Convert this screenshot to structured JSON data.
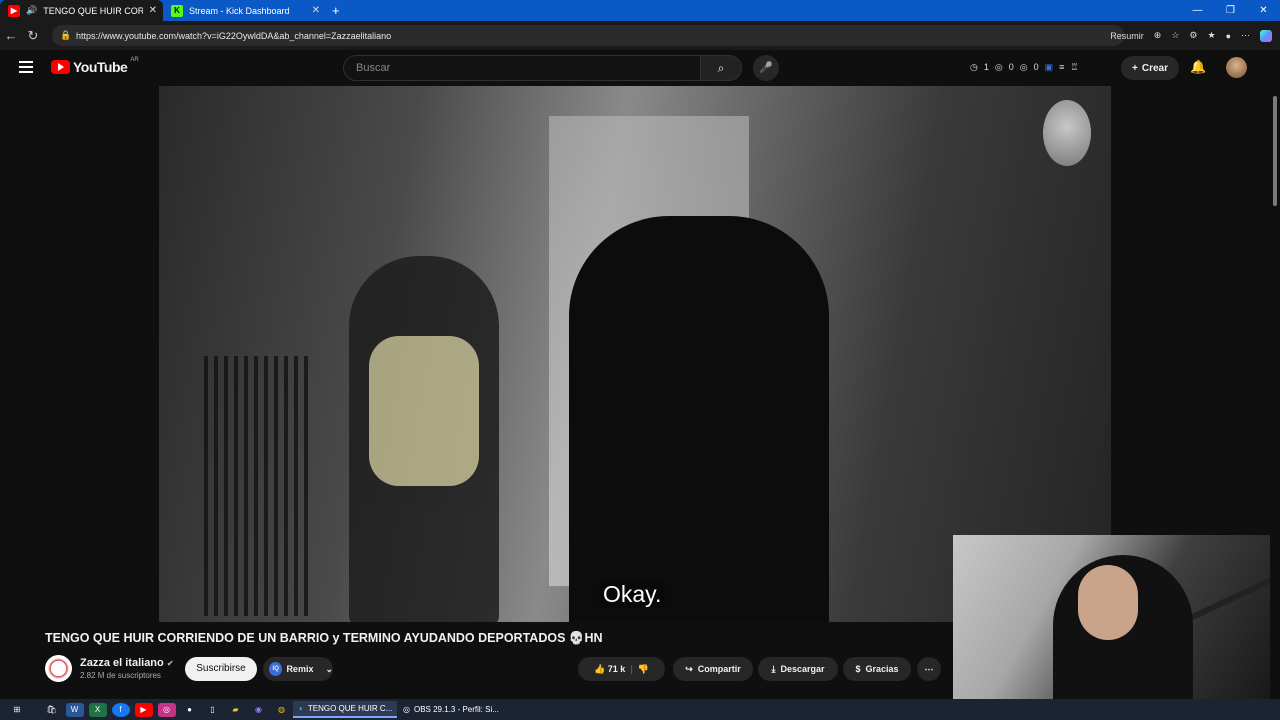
{
  "browser": {
    "tabs": [
      {
        "label": "TENGO QUE HUIR CORRIENDO",
        "icon": "youtube-icon",
        "active": true
      },
      {
        "label": "Stream - Kick Dashboard",
        "icon": "kick-icon",
        "active": false
      }
    ],
    "new_tab": "+",
    "url": "https://www.youtube.com/watch?v=iG22OywldDA&ab_channel=Zazzaelitaliano",
    "summarize_label": "Resumir"
  },
  "youtube": {
    "logo_text": "YouTube",
    "region": "AR",
    "search_placeholder": "Buscar",
    "ext_counts": [
      "1",
      "0",
      "0"
    ],
    "create_label": "Crear"
  },
  "video": {
    "caption": "Okay.",
    "title": "TENGO QUE HUIR CORRIENDO DE UN BARRIO y TERMINO AYUDANDO DEPORTADOS 💀HN"
  },
  "channel": {
    "name": "Zazza el italiano",
    "subscribers": "2.82 M de suscriptores",
    "subscribe_label": "Suscribirse",
    "remix_label": "Remix",
    "remix_badge": "IQ"
  },
  "actions": {
    "likes": "71 k",
    "share": "Compartir",
    "download": "Descargar",
    "thanks": "Gracias"
  },
  "taskbar": {
    "items": [
      {
        "label": "TENGO QUE HUIR C..."
      },
      {
        "label": "OBS 29.1.3 - Perfil: Si..."
      }
    ]
  }
}
